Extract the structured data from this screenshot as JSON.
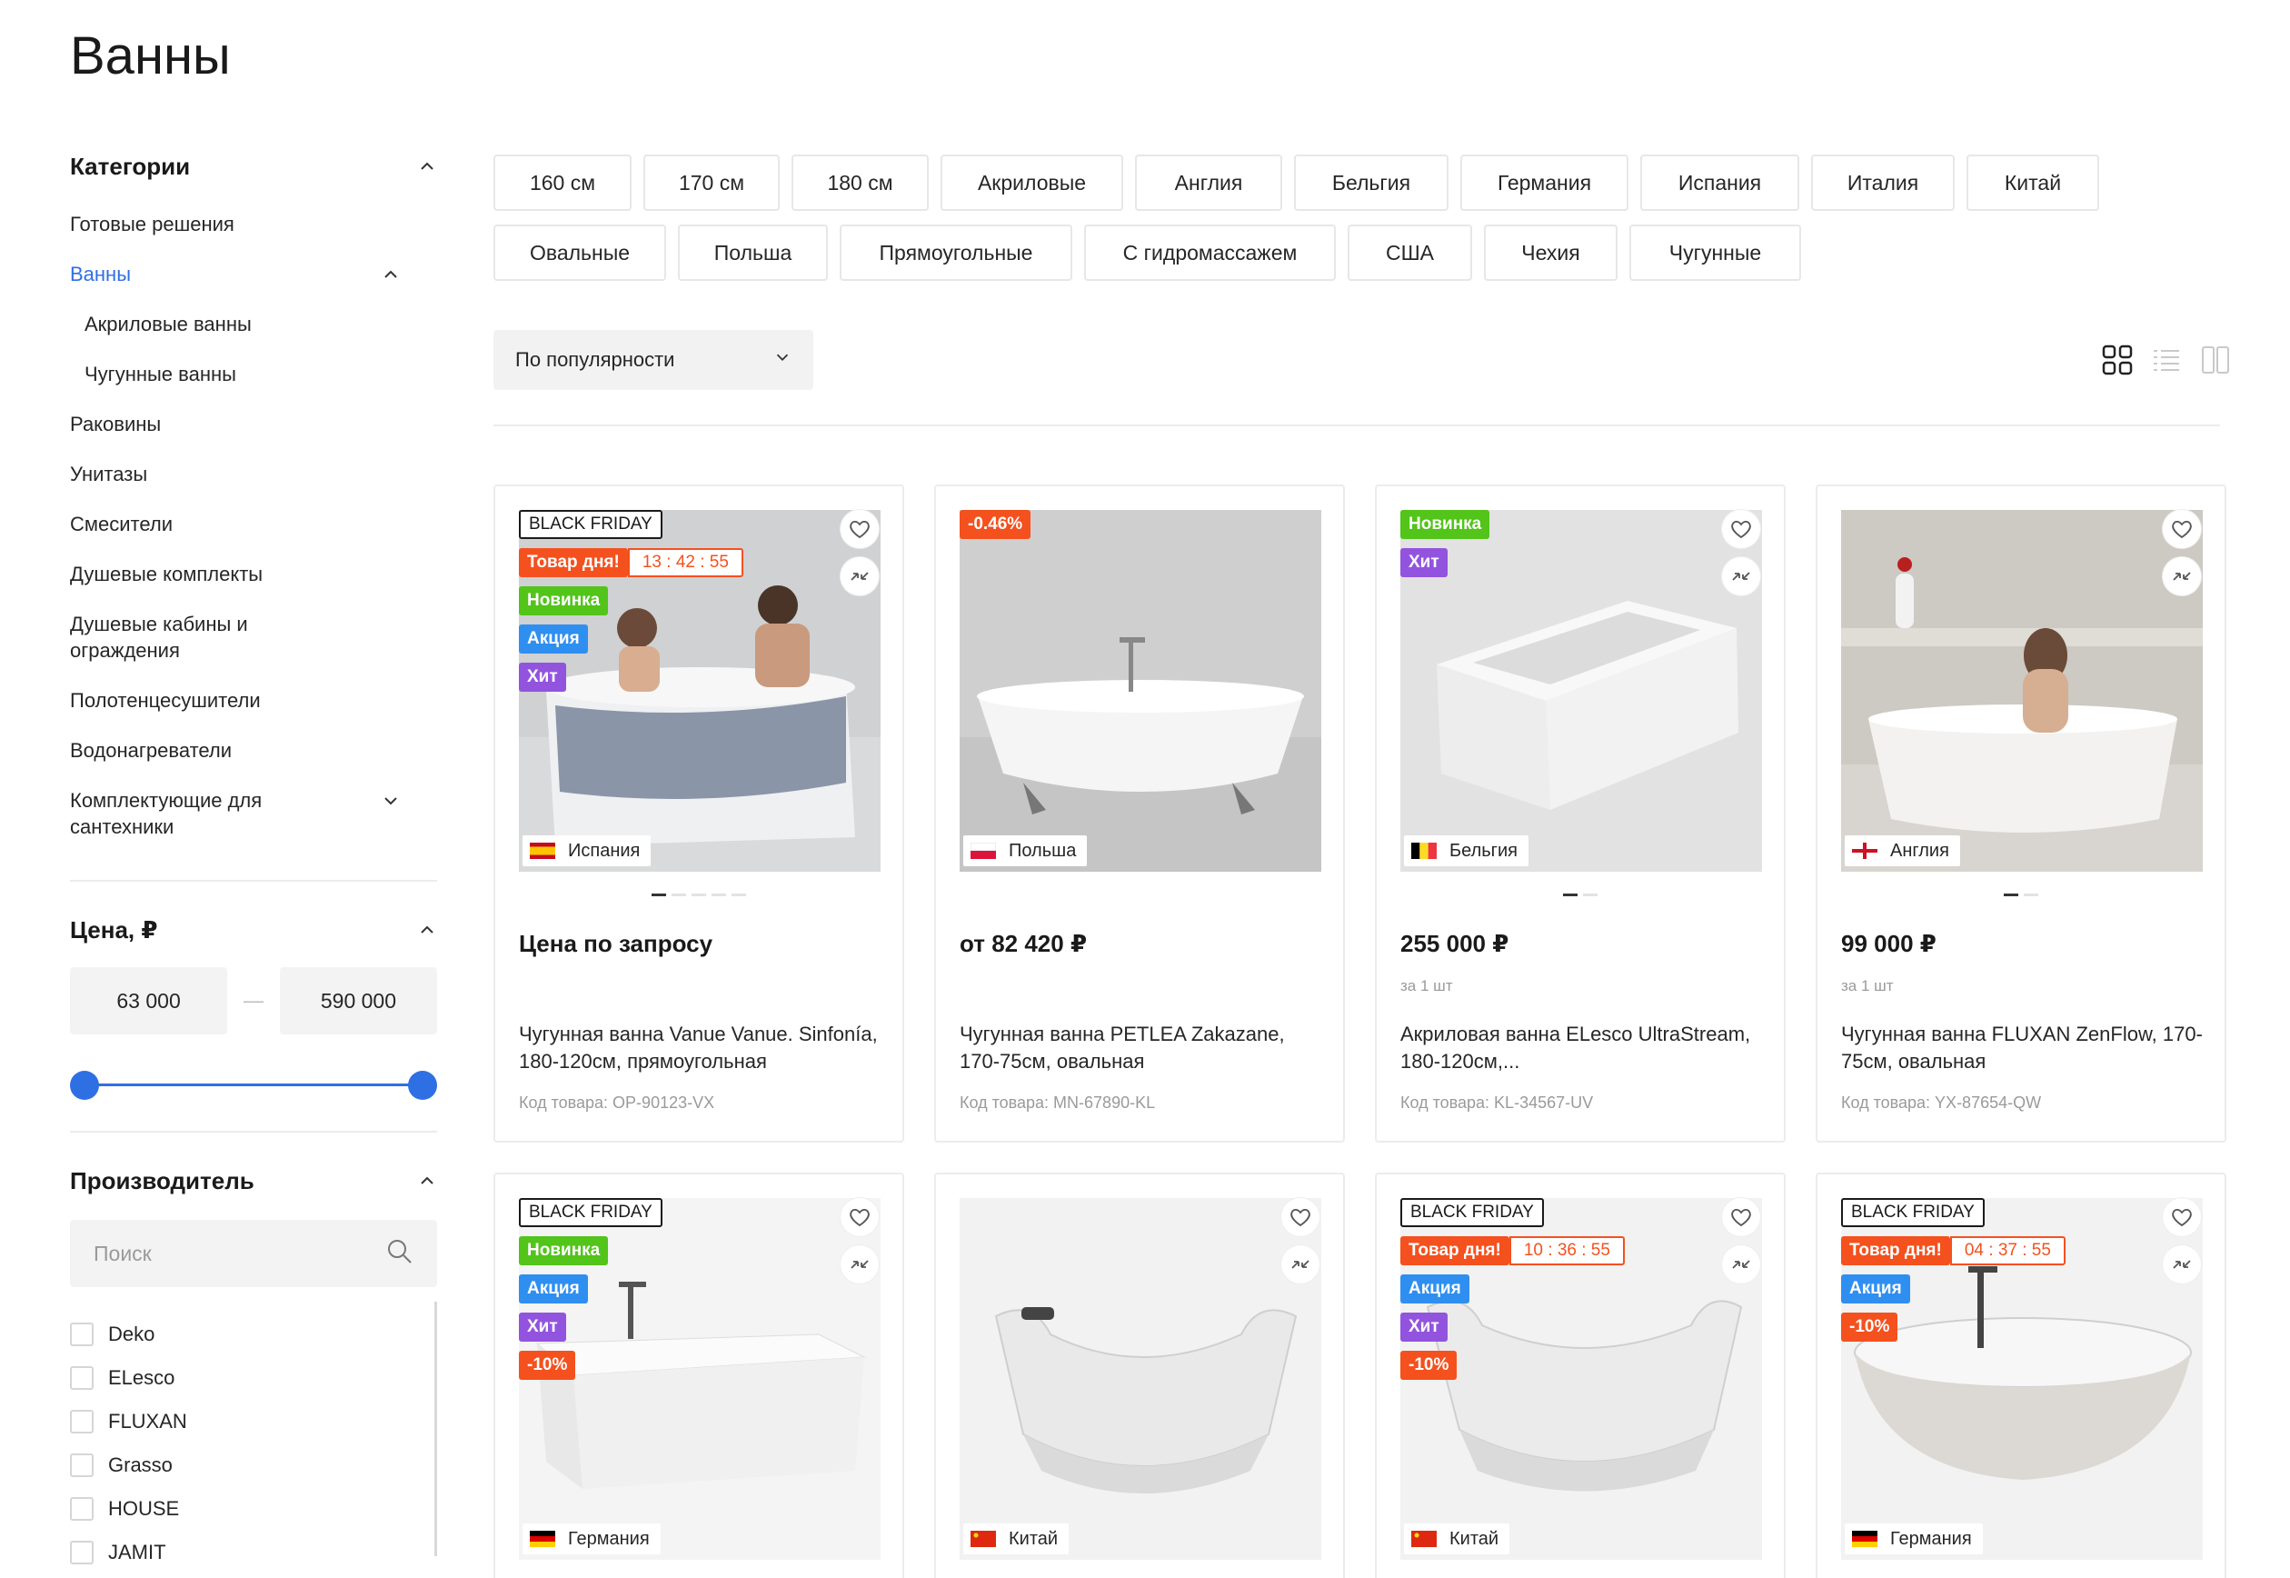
{
  "page_title": "Ванны",
  "sidebar": {
    "categories_title": "Категории",
    "categories": [
      {
        "label": "Готовые решения"
      },
      {
        "label": "Ванны"
      },
      {
        "label": "Акриловые ванны"
      },
      {
        "label": "Чугунные ванны"
      },
      {
        "label": "Раковины"
      },
      {
        "label": "Унитазы"
      },
      {
        "label": "Смесители"
      },
      {
        "label": "Душевые комплекты"
      },
      {
        "label": "Душевые кабины и ограждения"
      },
      {
        "label": "Полотенцесушители"
      },
      {
        "label": "Водонагреватели"
      },
      {
        "label": "Комплектующие для сантехники"
      }
    ],
    "price_title": "Цена, ₽",
    "price_min": "63 000",
    "price_max": "590 000",
    "price_dash": "—",
    "manufacturer_title": "Производитель",
    "manufacturer_search_placeholder": "Поиск",
    "manufacturers": [
      "Deko",
      "ELesco",
      "FLUXAN",
      "Grasso",
      "HOUSE",
      "JAMIT"
    ]
  },
  "tags": {
    "row1": [
      "160 см",
      "170 см",
      "180 см",
      "Акриловые",
      "Англия",
      "Бельгия",
      "Германия",
      "Испания",
      "Италия",
      "Китай"
    ],
    "row2": [
      "Овальные",
      "Польша",
      "Прямоугольные",
      "С гидромассажем",
      "США",
      "Чехия",
      "Чугунные"
    ]
  },
  "sort": {
    "label": "По популярности"
  },
  "badges": {
    "black_friday": "BLACK FRIDAY",
    "deal_of_day": "Товар дня!",
    "new": "Новинка",
    "promo": "Акция",
    "hit": "Хит"
  },
  "products": [
    {
      "timer": "13 : 42 : 55",
      "country": "Испания",
      "price": "Цена по запросу",
      "unit": "",
      "name": "Чугунная ванна Vanue Vanue. Sinfonía, 180-120см, прямоугольная",
      "code": "Код товара: OP-90123-VX"
    },
    {
      "discount": "-0.46%",
      "country": "Польша",
      "price": "от 82 420 ₽",
      "unit": "",
      "name": "Чугунная ванна PETLEA Zakazane, 170-75см, овальная",
      "code": "Код товара: MN-67890-KL"
    },
    {
      "country": "Бельгия",
      "price": "255 000 ₽",
      "unit": "за 1 шт",
      "name": "Акриловая ванна ELesco UltraStream, 180-120см,...",
      "code": "Код товара: KL-34567-UV"
    },
    {
      "country": "Англия",
      "price": "99 000 ₽",
      "unit": "за 1 шт",
      "name": "Чугунная ванна FLUXAN ZenFlow, 170-75см, овальная",
      "code": "Код товара: YX-87654-QW"
    },
    {
      "discount": "-10%",
      "country": "Германия"
    },
    {
      "country": "Китай"
    },
    {
      "timer": "10 : 36 : 55",
      "discount": "-10%",
      "country": "Китай"
    },
    {
      "timer": "04 : 37 : 55",
      "discount": "-10%",
      "country": "Германия"
    }
  ],
  "colors": {
    "accent": "#2f6fe4",
    "badge_new": "#52c41a",
    "badge_promo": "#2f8ff0",
    "badge_hit": "#9254de",
    "badge_sale": "#f4511e"
  }
}
